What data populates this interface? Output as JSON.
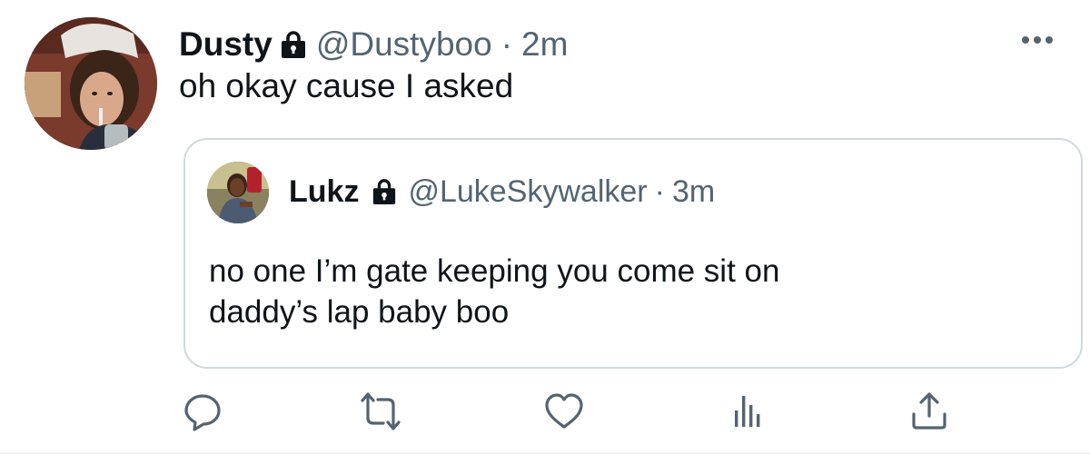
{
  "tweet": {
    "author": {
      "name": "Dusty",
      "handle": "@Dustyboo",
      "time": "2m",
      "avatar": "profile-photo"
    },
    "separator": "·",
    "text": "oh okay cause I asked",
    "more_icon": "more-horizontal-icon"
  },
  "quote": {
    "author": {
      "name": "Lukz",
      "handle": "@LukeSkywalker",
      "time": "3m",
      "avatar": "profile-photo"
    },
    "separator": "·",
    "text_lines": [
      "no one I’m gate keeping you come sit on",
      "daddy’s lap baby boo"
    ]
  },
  "actions": [
    {
      "name": "reply",
      "icon": "reply-icon"
    },
    {
      "name": "retweet",
      "icon": "retweet-icon"
    },
    {
      "name": "like",
      "icon": "heart-icon"
    },
    {
      "name": "analytics",
      "icon": "analytics-icon"
    },
    {
      "name": "share",
      "icon": "share-icon"
    }
  ],
  "colors": {
    "text": "#0f1419",
    "secondary": "#536471",
    "border": "#cfd9de",
    "background": "#ffffff"
  }
}
